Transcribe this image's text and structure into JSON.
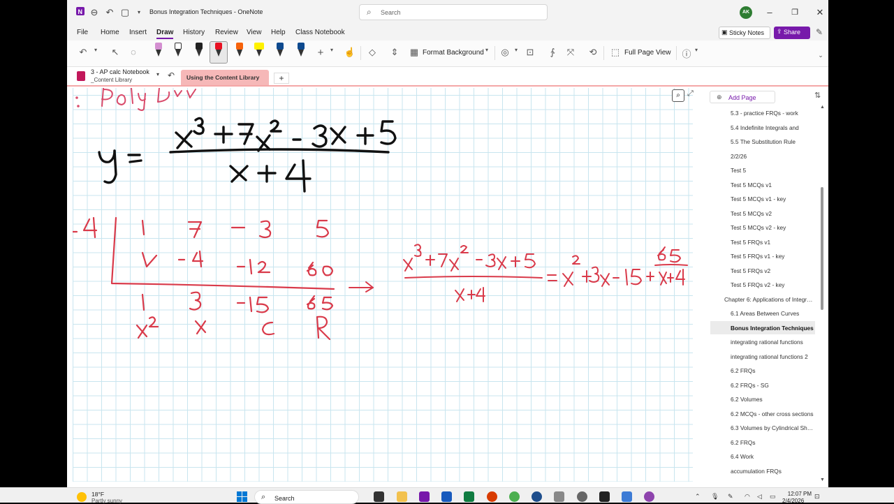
{
  "window": {
    "title": "Bonus Integration Techniques  -  OneNote",
    "search_placeholder": "Search",
    "avatar_initials": "AK"
  },
  "menu": {
    "tabs": [
      "File",
      "Home",
      "Insert",
      "Draw",
      "History",
      "Review",
      "View",
      "Help",
      "Class Notebook"
    ],
    "active": "Draw",
    "sticky_notes": "Sticky Notes",
    "share": "Share"
  },
  "ribbon": {
    "format_background": "Format Background",
    "full_page_view": "Full Page View",
    "pens": [
      {
        "cap": "#d48fd1"
      },
      {
        "cap": "#ffffff"
      },
      {
        "cap": "#222222"
      },
      {
        "cap": "#e81123"
      },
      {
        "cap": "#f7630c"
      },
      {
        "cap": "#fff100"
      },
      {
        "cap": "#0e4a8f"
      },
      {
        "cap": "#0e4a8f"
      }
    ]
  },
  "notebook": {
    "name": "3 - AP calc Notebook",
    "section_group": "_Content Library",
    "active_section": "Using the Content Library"
  },
  "pages": {
    "add_page": "Add Page",
    "items": [
      "5.3 - practice FRQs - work",
      "5.4 Indefinite Integrals and",
      "5.5 The Substitution Rule",
      "2/2/26",
      "Test 5",
      "Test 5 MCQs v1",
      "Test 5 MCQs v1 - key",
      "Test 5 MCQs v2",
      "Test 5 MCQs v2 - key",
      "Test 5 FRQs v1",
      "Test 5 FRQs v1 - key",
      "Test 5 FRQs v2",
      "Test 5 FRQs v2 - key",
      "Chapter 6: Applications of Integration",
      "6.1 Areas Between Curves",
      "Bonus Integration Techniques",
      "integrating rational functions",
      "integrating rational functions 2",
      "6.2 FRQs",
      "6.2 FRQs - SG",
      "6.2 Volumes",
      "6.2 MCQs - other cross sections",
      "6.3 Volumes by Cylindrical Shells",
      "6.2 FRQs",
      "6.4 Work",
      "accumulation FRQs"
    ],
    "active_index": 15
  },
  "taskbar": {
    "temperature": "18°F",
    "weather": "Partly sunny",
    "search": "Search",
    "time": "12:07 PM",
    "date": "2/4/2026"
  },
  "ink": {
    "top_partial": ": Poly Div",
    "equation": "y = (x³ + 7x² - 3x + 5) / (x + 4)",
    "synthetic_divisor": "-4",
    "row1": [
      "1",
      "7",
      "-3",
      "5"
    ],
    "row2": [
      "↓",
      "-4",
      "-12",
      "60"
    ],
    "row3": [
      "1",
      "3",
      "-15",
      "65"
    ],
    "row4": [
      "x²",
      "x",
      "c",
      "R"
    ],
    "result": "(x³+7x²-3x+5)/(x+4) = x²+3x-15+65/(x+4)"
  }
}
